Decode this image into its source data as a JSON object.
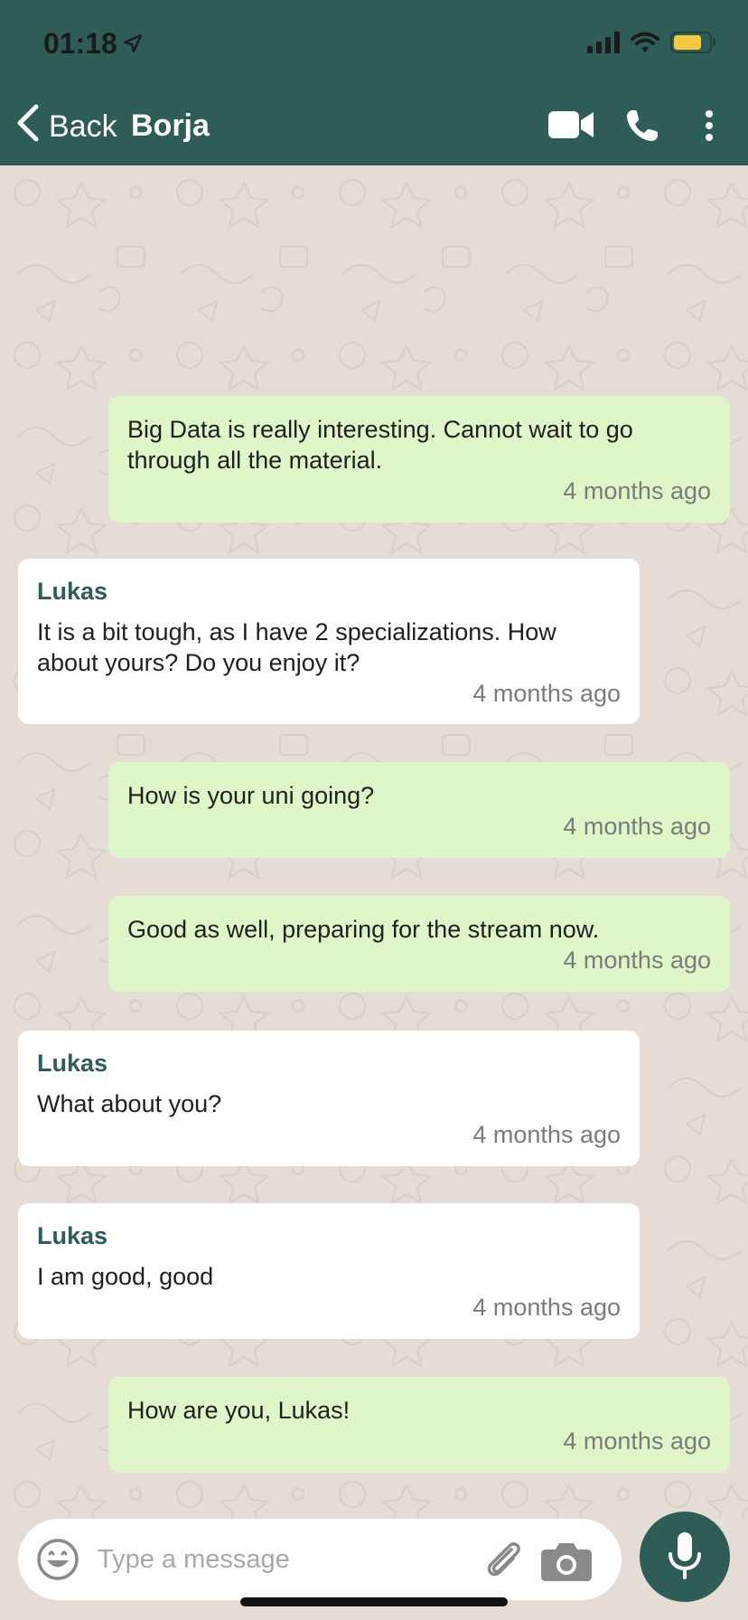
{
  "status_bar": {
    "time": "01:18"
  },
  "header": {
    "back_label": "Back",
    "contact_name": "Borja",
    "icons": [
      "video-call-icon",
      "phone-icon",
      "more-vertical-icon"
    ]
  },
  "messages": [
    {
      "direction": "out",
      "sender": "",
      "text": "Big Data is really interesting. Cannot wait to go through all the material.",
      "time": "4 months ago"
    },
    {
      "direction": "in",
      "sender": "Lukas",
      "text": "It is a bit tough, as I have 2 specializations. How about yours? Do you enjoy it?",
      "time": "4 months ago"
    },
    {
      "direction": "out",
      "sender": "",
      "text": "How is your uni going?",
      "time": "4 months ago"
    },
    {
      "direction": "out",
      "sender": "",
      "text": "Good as well, preparing for the stream now.",
      "time": "4 months ago"
    },
    {
      "direction": "in",
      "sender": "Lukas",
      "text": "What about you?",
      "time": "4 months ago"
    },
    {
      "direction": "in",
      "sender": "Lukas",
      "text": "I am good, good",
      "time": "4 months ago"
    },
    {
      "direction": "out",
      "sender": "",
      "text": "How are you, Lukas!",
      "time": "4 months ago"
    }
  ],
  "composer": {
    "placeholder": "Type a message",
    "icons": [
      "emoji-icon",
      "paperclip-icon",
      "camera-icon",
      "microphone-icon"
    ]
  },
  "colors": {
    "header": "#2e5d57",
    "outgoing_bubble": "#dff7c8",
    "incoming_bubble": "#ffffff",
    "sender_name": "#2e5d57",
    "wallpaper": "#e5ddd5",
    "battery": "#f5c842"
  }
}
